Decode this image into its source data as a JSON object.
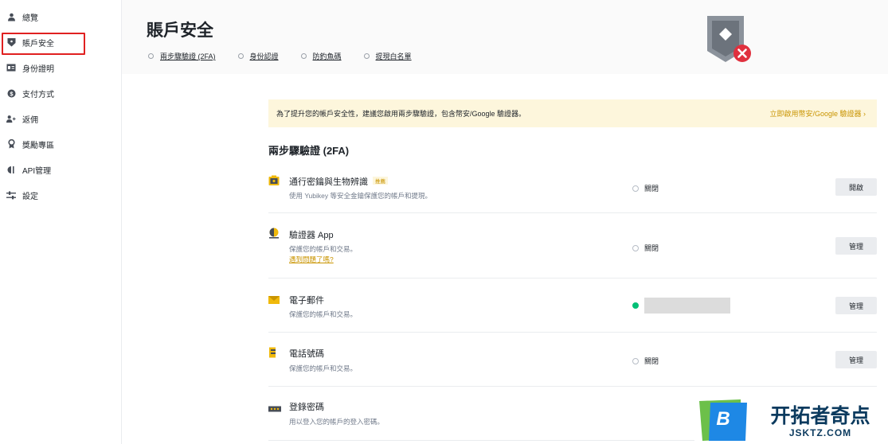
{
  "sidebar": {
    "items": [
      {
        "label": "總覽",
        "icon": "user-icon"
      },
      {
        "label": "賬戶安全",
        "icon": "shield-icon",
        "active": true
      },
      {
        "label": "身份證明",
        "icon": "id-card-icon"
      },
      {
        "label": "支付方式",
        "icon": "dollar-icon"
      },
      {
        "label": "返佣",
        "icon": "add-user-icon"
      },
      {
        "label": "獎勵專區",
        "icon": "award-icon"
      },
      {
        "label": "API管理",
        "icon": "api-icon"
      },
      {
        "label": "設定",
        "icon": "sliders-icon"
      }
    ]
  },
  "header": {
    "title": "賬戶安全",
    "tabs": [
      "兩步驟驗證 (2FA)",
      "身份認證",
      "防釣魚碼",
      "提現白名單"
    ]
  },
  "banner": {
    "text": "為了提升您的帳戶安全性，建議您啟用兩步驟驗證，包含幣安/Google 驗證器。",
    "link": "立即啟用幣安/Google 驗證器 ›"
  },
  "section_title": "兩步驟驗證 (2FA)",
  "rows": [
    {
      "title": "通行密鑰與生物辨識",
      "tag": "推薦",
      "desc": "使用 Yubikey 等安全金鑰保護您的帳戶和提現。",
      "status": "關閉",
      "button": "開啟"
    },
    {
      "title": "驗證器 App",
      "desc": "保護您的帳戶和交易。",
      "link": "遇到問題了嗎?",
      "status": "關閉",
      "button": "管理"
    },
    {
      "title": "電子郵件",
      "desc": "保護您的帳戶和交易。",
      "status": "",
      "button": "管理"
    },
    {
      "title": "電話號碼",
      "desc": "保護您的帳戶和交易。",
      "status": "關閉",
      "button": "管理"
    },
    {
      "title": "登錄密碼",
      "desc": "用以登入您的帳戶的登入密碼。"
    }
  ],
  "watermark": {
    "main": "开拓者奇点",
    "sub": "JSKTZ.COM",
    "letter": "B"
  },
  "colors": {
    "accent": "#c99400",
    "banner_bg": "#fdf6dc",
    "highlight": "#e02020",
    "success": "#02c076"
  }
}
